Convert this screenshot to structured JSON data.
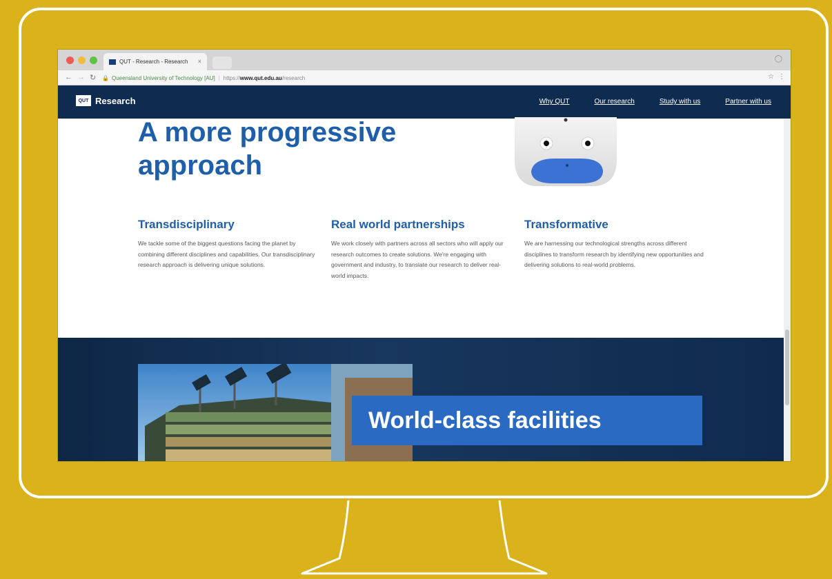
{
  "browser": {
    "tab_title": "QUT - Research - Research",
    "tab_close": "×",
    "url_org": "Queensland University of Technology [AU]",
    "url_protocol": "https://",
    "url_domain": "www.qut.edu.au",
    "url_path": "/research"
  },
  "site": {
    "logo_badge": "QUT",
    "logo_text": "Research",
    "nav": [
      "Why QUT",
      "Our research",
      "Study with us",
      "Partner with us"
    ]
  },
  "hero": {
    "title_line1": "A more progressive",
    "title_line2": "approach"
  },
  "columns": [
    {
      "heading": "Transdisciplinary",
      "body": "We tackle some of the biggest questions facing the planet by combining different disciplines and capabilities. Our transdisciplinary research approach is delivering unique solutions."
    },
    {
      "heading": "Real world partnerships",
      "body": "We work closely with partners across all sectors who will apply our research outcomes to create solutions. We're engaging with government and industry, to translate our research to deliver real-world impacts."
    },
    {
      "heading": "Transformative",
      "body": "We are harnessing our technological strengths across different disciplines to transform research by identifying new opportunities and delivering solutions to real-world problems."
    }
  ],
  "facilities": {
    "label": "World-class facilities"
  },
  "colors": {
    "background": "#d9b21c",
    "navy": "#0f2b4f",
    "accent_blue": "#1f5ea8",
    "label_blue": "#2a6ac3"
  },
  "icons": {
    "back": "arrow-left-icon",
    "forward": "arrow-right-icon",
    "reload": "reload-icon",
    "lock": "lock-icon",
    "bookmark": "star-icon",
    "menu": "menu-dots-icon"
  }
}
